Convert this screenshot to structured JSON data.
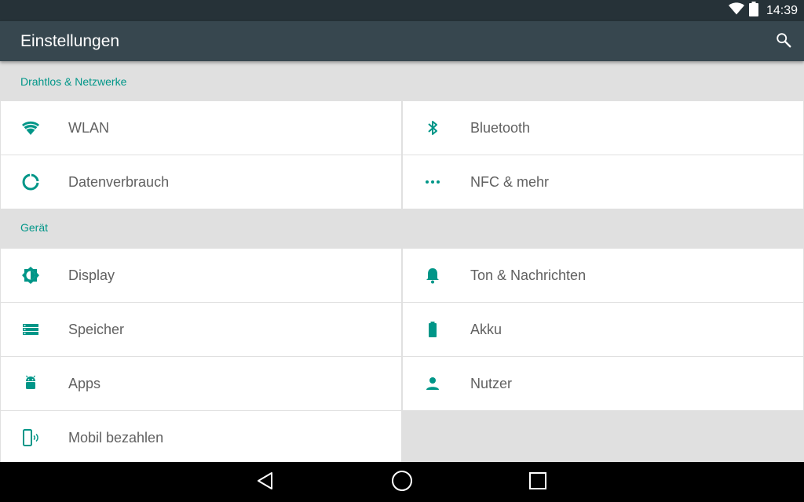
{
  "status_bar": {
    "time": "14:39",
    "wifi_icon": "wifi-icon",
    "battery_icon": "battery-icon"
  },
  "app_bar": {
    "title": "Einstellungen",
    "search_icon": "search-icon"
  },
  "accent_color": "#009688",
  "sections": [
    {
      "title": "Drahtlos & Netzwerke",
      "items": [
        {
          "label": "WLAN",
          "icon": "wifi-icon"
        },
        {
          "label": "Bluetooth",
          "icon": "bluetooth-icon"
        },
        {
          "label": "Datenverbrauch",
          "icon": "data-usage-icon"
        },
        {
          "label": "NFC & mehr",
          "icon": "more-icon"
        }
      ]
    },
    {
      "title": "Gerät",
      "items": [
        {
          "label": "Display",
          "icon": "brightness-icon"
        },
        {
          "label": "Ton & Nachrichten",
          "icon": "bell-icon"
        },
        {
          "label": "Speicher",
          "icon": "storage-icon"
        },
        {
          "label": "Akku",
          "icon": "battery-icon"
        },
        {
          "label": "Apps",
          "icon": "android-icon"
        },
        {
          "label": "Nutzer",
          "icon": "person-icon"
        },
        {
          "label": "Mobil bezahlen",
          "icon": "tap-pay-icon"
        }
      ]
    }
  ],
  "nav_bar": {
    "back_icon": "back-icon",
    "home_icon": "home-icon",
    "recents_icon": "recents-icon"
  }
}
